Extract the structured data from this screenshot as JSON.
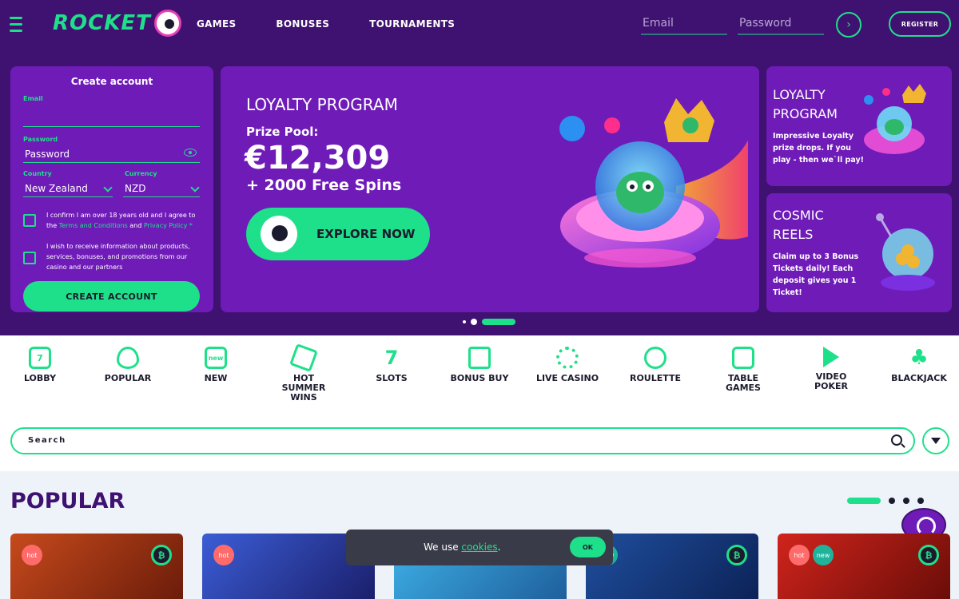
{
  "header": {
    "logo": "ROCKET",
    "nav": [
      "GAMES",
      "BONUSES",
      "TOURNAMENTS"
    ],
    "email_placeholder": "Email",
    "password_placeholder": "Password",
    "register": "REGISTER",
    "go_icon": "chevron-right-icon"
  },
  "signup": {
    "title": "Create account",
    "email_label": "Email",
    "email_value": "",
    "password_label": "Password",
    "password_value": "Password",
    "country_label": "Country",
    "country_value": "New Zealand",
    "currency_label": "Currency",
    "currency_value": "NZD",
    "terms_pre": "I confirm I am over 18 years old and I agree to the ",
    "terms_link": "Terms and Conditions",
    "terms_and": " and ",
    "privacy_link": "Privacy Policy",
    "terms_star": " *",
    "marketing_text": "I wish to receive information about products, services, bonuses, and promotions from our casino and our partners",
    "create_button": "CREATE ACCOUNT"
  },
  "banner": {
    "title": "LOYALTY PROGRAM",
    "prize_label": "Prize Pool:",
    "prize_amount": "€12,309",
    "prize_spins": "+ 2000 Free Spins",
    "cta": "EXPLORE NOW"
  },
  "side_cards": [
    {
      "title": "LOYALTY PROGRAM",
      "text": "Impressive Loyalty prize drops. If you play - then we`ll pay!"
    },
    {
      "title": "COSMIC REELS",
      "text": "Claim up to 3 Bonus Tickets daily! Each deposit gives you 1 Ticket!"
    }
  ],
  "carousel": {
    "slides": 3,
    "active": 2
  },
  "categories": [
    {
      "label": "LOBBY",
      "icon": "lobby-icon"
    },
    {
      "label": "POPULAR",
      "icon": "flame-icon"
    },
    {
      "label": "NEW",
      "icon": "new-icon",
      "glyph": "new"
    },
    {
      "label": "HOT SUMMER WINS",
      "icon": "party-icon"
    },
    {
      "label": "SLOTS",
      "icon": "seven-icon",
      "glyph": "7"
    },
    {
      "label": "BONUS BUY",
      "icon": "gift-icon"
    },
    {
      "label": "LIVE CASINO",
      "icon": "chip-icon"
    },
    {
      "label": "ROULETTE",
      "icon": "roulette-icon"
    },
    {
      "label": "TABLE GAMES",
      "icon": "dice-icon"
    },
    {
      "label": "VIDEO POKER",
      "icon": "play-icon"
    },
    {
      "label": "BLACKJACK",
      "icon": "club-icon"
    }
  ],
  "search": {
    "placeholder": "Search"
  },
  "popular": {
    "title": "POPULAR",
    "pages": 4,
    "active_page": 1
  },
  "games": [
    {
      "badges": [
        "hot"
      ],
      "btc": true,
      "colors": [
        "#c64a1c",
        "#6b1c0a"
      ]
    },
    {
      "badges": [
        "hot"
      ],
      "btc": false,
      "colors": [
        "#3c5dd6",
        "#1a1f6b"
      ]
    },
    {
      "badges": [],
      "btc": false,
      "colors": [
        "#3fb2e8",
        "#1e5f9c"
      ]
    },
    {
      "badges": [
        "new"
      ],
      "btc": true,
      "colors": [
        "#1f4f9e",
        "#0c2257"
      ]
    },
    {
      "badges": [
        "hot",
        "new"
      ],
      "btc": true,
      "colors": [
        "#d0241c",
        "#6a0d08"
      ]
    }
  ],
  "badge_labels": {
    "hot": "hot",
    "new": "new"
  },
  "cookie": {
    "text": "We use ",
    "link": "cookies",
    "end": ".",
    "ok": "OK"
  },
  "colors": {
    "purple_dark": "#3f1170",
    "purple": "#6f1bb8",
    "green": "#1fe08a",
    "ink": "#1b1b2e"
  }
}
